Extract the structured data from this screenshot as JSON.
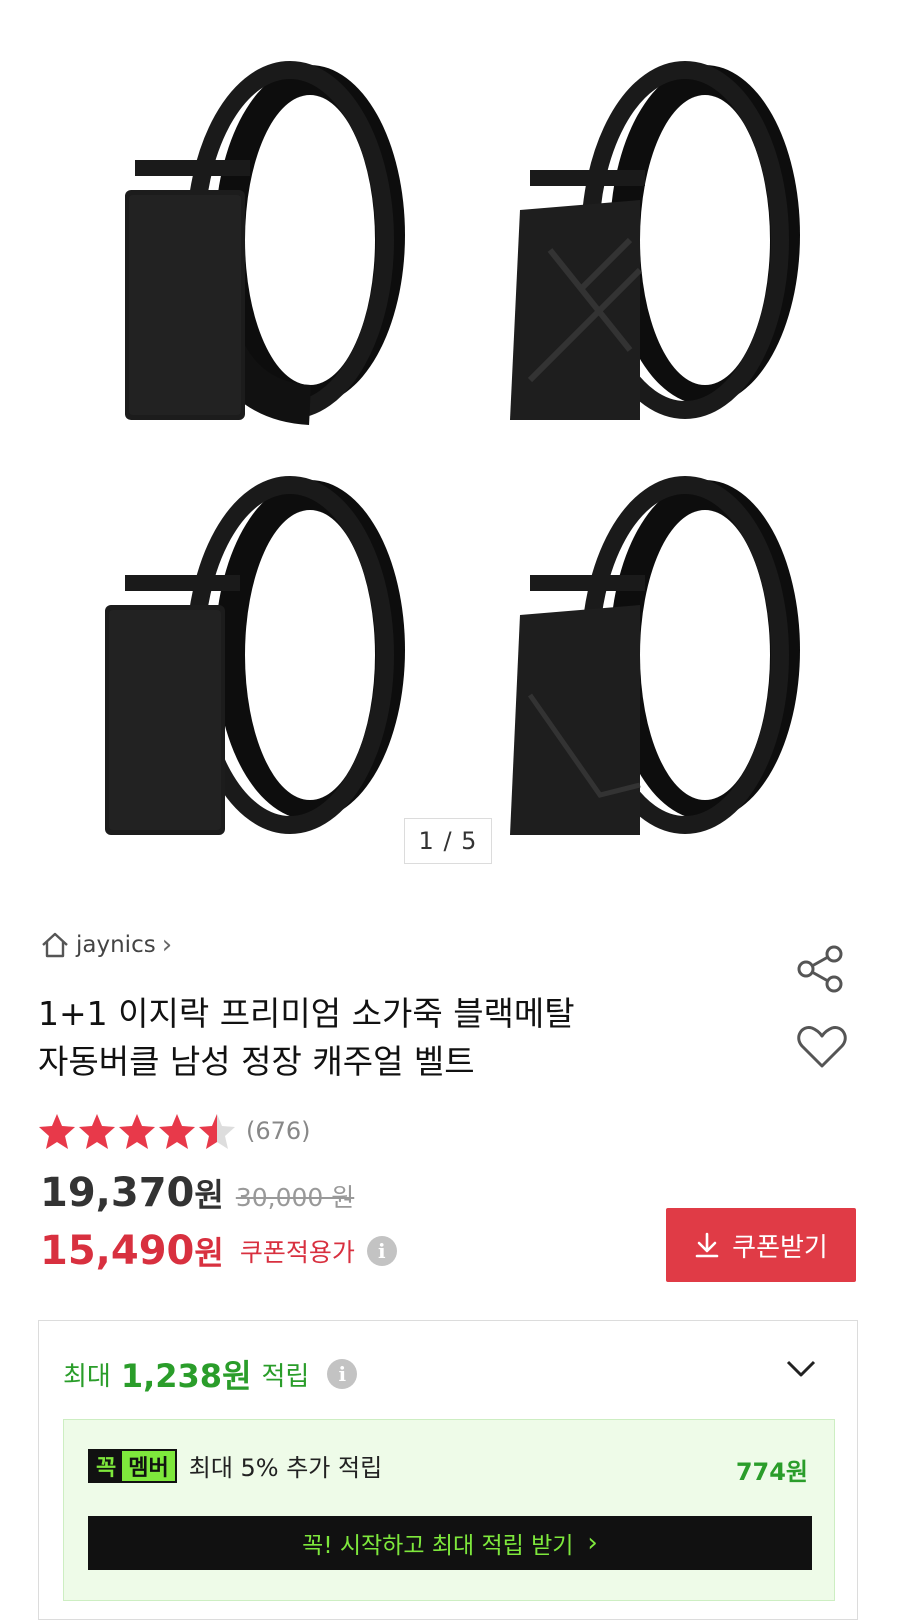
{
  "gallery": {
    "counter": "1 / 5",
    "items": [
      "belt-plain",
      "belt-cross",
      "belt-plain-2",
      "belt-diagonal"
    ]
  },
  "seller": {
    "name": "jaynics",
    "chevron": "›"
  },
  "product": {
    "title_line1": "1+1 이지락 프리미엄 소가죽 블랙메탈",
    "title_line2": "자동버클 남성 정장 캐주얼 벨트",
    "rating": 4.5,
    "review_count": "(676)"
  },
  "price": {
    "sale": "19,370",
    "unit": "원",
    "original": "30,000 원",
    "coupon_price": "15,490",
    "coupon_unit": "원",
    "coupon_label": "쿠폰적용가",
    "info_glyph": "i"
  },
  "coupon_button": {
    "label": "쿠폰받기"
  },
  "reward": {
    "prefix": "최대",
    "amount": "1,238원",
    "suffix": "적립",
    "member_badge_1": "꼭",
    "member_badge_2": "멤버",
    "member_text": "최대 5% 추가 적립",
    "member_amount": "774원",
    "start_label": "꼭! 시작하고 최대 적립 받기",
    "start_chevron": "›"
  },
  "colors": {
    "accent_red": "#e03b46",
    "price_red": "#d8303f",
    "reward_green": "#2a9d2a",
    "member_green": "#7ee83c"
  },
  "icons": [
    "home-icon",
    "chevron-right-icon",
    "share-icon",
    "heart-icon",
    "star-icon",
    "info-icon",
    "download-icon",
    "chevron-down-icon"
  ]
}
